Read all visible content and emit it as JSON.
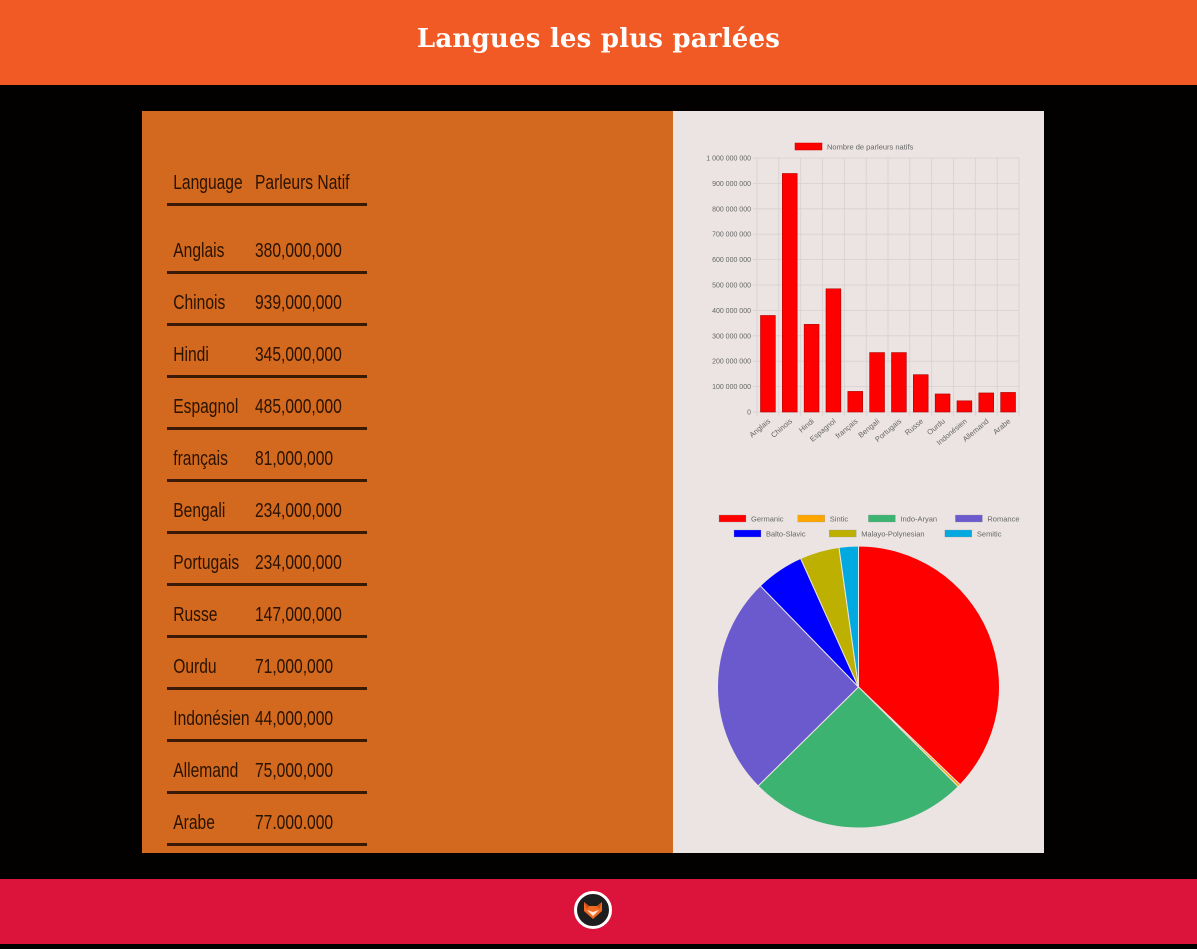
{
  "header": {
    "title": "Langues les plus parlées"
  },
  "table": {
    "col_language": "Language",
    "col_speakers": "Parleurs Natif",
    "rows": [
      {
        "language": "Anglais",
        "speakers": "380,000,000"
      },
      {
        "language": "Chinois",
        "speakers": "939,000,000"
      },
      {
        "language": "Hindi",
        "speakers": "345,000,000"
      },
      {
        "language": "Espagnol",
        "speakers": "485,000,000"
      },
      {
        "language": "français",
        "speakers": "81,000,000"
      },
      {
        "language": "Bengali",
        "speakers": "234,000,000"
      },
      {
        "language": "Portugais",
        "speakers": "234,000,000"
      },
      {
        "language": "Russe",
        "speakers": "147,000,000"
      },
      {
        "language": "Ourdu",
        "speakers": "71,000,000"
      },
      {
        "language": "Indonésien",
        "speakers": "44,000,000"
      },
      {
        "language": "Allemand",
        "speakers": "75,000,000"
      },
      {
        "language": "Arabe",
        "speakers": "77.000.000"
      }
    ]
  },
  "chart_data": [
    {
      "type": "bar",
      "categories": [
        "Anglais",
        "Chinois",
        "Hindi",
        "Espagnol",
        "français",
        "Bengali",
        "Portugais",
        "Russe",
        "Ourdu",
        "Indonésien",
        "Allemand",
        "Arabe"
      ],
      "series": [
        {
          "name": "Nombre de parleurs natifs",
          "values": [
            380000000,
            939000000,
            345000000,
            485000000,
            81000000,
            234000000,
            234000000,
            147000000,
            71000000,
            44000000,
            75000000,
            77000000
          ],
          "color": "#ff0000"
        }
      ],
      "yticks": [
        "0",
        "100 000 000",
        "200 000 000",
        "300 000 000",
        "400 000 000",
        "500 000 000",
        "600 000 000",
        "700 000 000",
        "800 000 000",
        "900 000 000",
        "1 000 000 000"
      ],
      "ylim": [
        0,
        1000000000
      ],
      "grid": true,
      "legend": "top"
    },
    {
      "type": "pie",
      "slices": [
        {
          "label": "Germanic",
          "value": 37,
          "color": "#ff0000"
        },
        {
          "label": "Sintic",
          "value": 0.3,
          "color": "#ffa500"
        },
        {
          "label": "Indo-Aryan",
          "value": 25,
          "color": "#3cb371"
        },
        {
          "label": "Romance",
          "value": 25,
          "color": "#6a5acd"
        },
        {
          "label": "Balto-Slavic",
          "value": 5.5,
          "color": "#0000ff"
        },
        {
          "label": "Malayo-Polynesian",
          "value": 4.5,
          "color": "#bdb000"
        },
        {
          "label": "Semitic",
          "value": 2.2,
          "color": "#00a9e0"
        }
      ],
      "legend": "top"
    }
  ]
}
